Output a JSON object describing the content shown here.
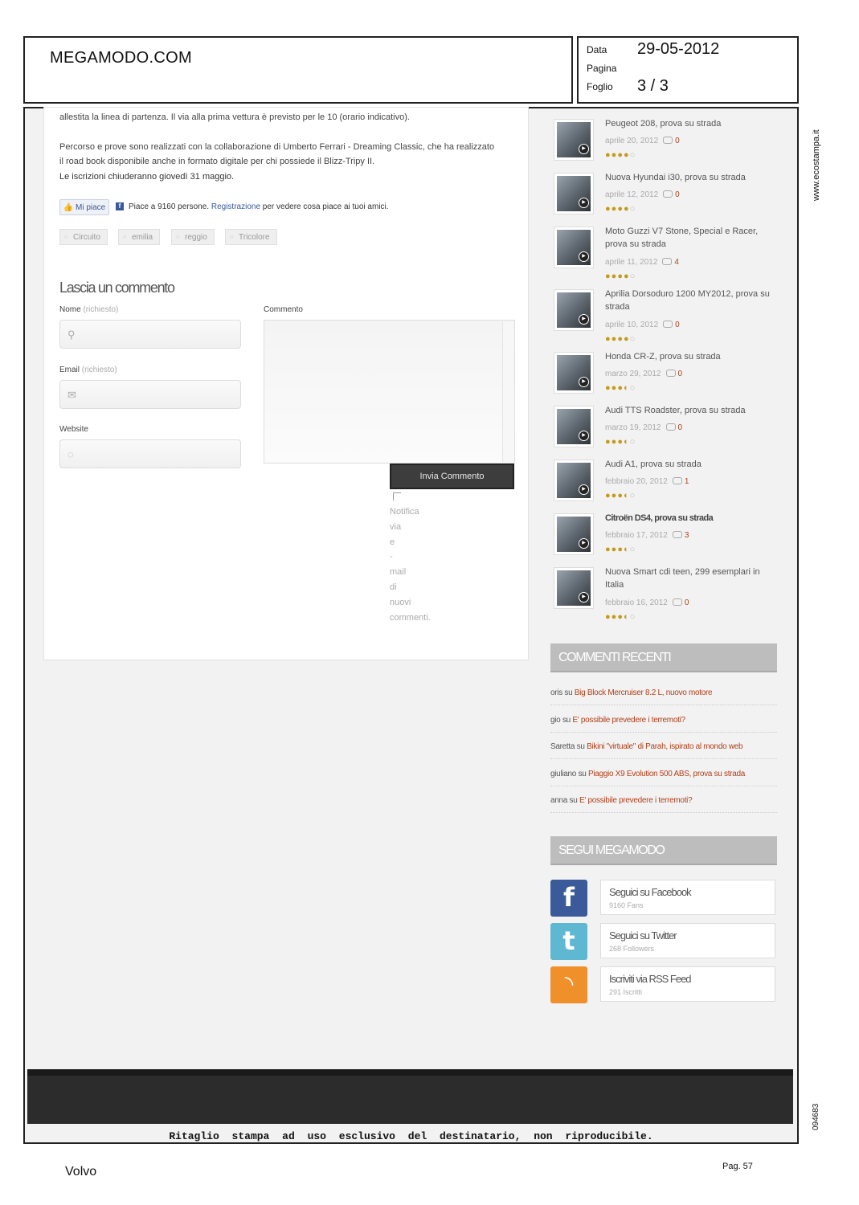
{
  "header": {
    "site": "MEGAMODO.COM",
    "data_label": "Data",
    "data_value": "29-05-2012",
    "pagina_label": "Pagina",
    "foglio_label": "Foglio",
    "foglio_value": "3 / 3"
  },
  "side_url": "www.ecostampa.it",
  "side_code": "094683",
  "article": {
    "line0": "allestita la linea di partenza. Il via alla prima vettura è previsto per le 10 (orario indicativo).",
    "line1": "Percorso e prove sono realizzati con la collaborazione di Umberto Ferrari -  Dreaming Classic, che ha realizzato",
    "line2": "il road book disponibile anche in formato digitale per chi possiede il Blizz-Tripy II.",
    "line3": "Le iscrizioni chiuderanno giovedì 31 maggio.",
    "like_button": "Mi piace",
    "like_text_pre": "Piace a 9160 persone.",
    "like_link": "Registrazione",
    "like_text_post": "per vedere cosa piace ai tuoi amici.",
    "tags": [
      "Circuito",
      "emilia",
      "reggio",
      "Tricolore"
    ]
  },
  "comment_form": {
    "title": "Lascia un commento",
    "name_label": "Nome",
    "email_label": "Email",
    "required": "(richiesto)",
    "website_label": "Website",
    "comment_label": "Commento",
    "submit": "Invia Commento",
    "notify_words": [
      "Notifica",
      "via",
      "e",
      "-",
      "mail",
      "di",
      "nuovi",
      "commenti."
    ]
  },
  "posts": [
    {
      "title": "Peugeot 208, prova su strada",
      "date": "aprile 20, 2012",
      "comments": "0",
      "rating": 4
    },
    {
      "title": "Nuova Hyundai i30, prova su strada",
      "date": "aprile 12, 2012",
      "comments": "0",
      "rating": 4
    },
    {
      "title": "Moto Guzzi V7 Stone, Special e Racer, prova su strada",
      "date": "aprile 11, 2012",
      "comments": "4",
      "rating": 4
    },
    {
      "title": "Aprilia Dorsoduro 1200 MY2012, prova su strada",
      "date": "aprile 10, 2012",
      "comments": "0",
      "rating": 4
    },
    {
      "title": "Honda CR-Z, prova su strada",
      "date": "marzo 29, 2012",
      "comments": "0",
      "rating": 3.5
    },
    {
      "title": "Audi TTS Roadster, prova su strada",
      "date": "marzo 19, 2012",
      "comments": "0",
      "rating": 3.5
    },
    {
      "title": "Audi A1, prova su strada",
      "date": "febbraio 20, 2012",
      "comments": "1",
      "rating": 3.5
    },
    {
      "title": "Citroën DS4, prova su strada",
      "date": "febbraio 17, 2012",
      "comments": "3",
      "rating": 3.5
    },
    {
      "title": "Nuova Smart cdi teen, 299 esemplari in Italia",
      "date": "febbraio 16, 2012",
      "comments": "0",
      "rating": 3.5
    }
  ],
  "recent_comments": {
    "title": "COMMENTI RECENTI",
    "items": [
      {
        "author": "oris",
        "on": "su",
        "post": "Big Block Mercruiser 8.2 L, nuovo motore"
      },
      {
        "author": "gio",
        "on": "su",
        "post": "E' possibile prevedere i terremoti?"
      },
      {
        "author": "Saretta",
        "on": "su",
        "post": "Bikini \"virtuale\" di Parah, ispirato al mondo web"
      },
      {
        "author": "giuliano",
        "on": "su",
        "post": "Piaggio X9 Evolution 500 ABS, prova su strada"
      },
      {
        "author": "anna",
        "on": "su",
        "post": "E' possibile prevedere i terremoti?"
      }
    ]
  },
  "follow": {
    "title": "SEGUI MEGAMODO",
    "items": [
      {
        "label": "Seguici su Facebook",
        "sub": "9160 Fans",
        "icon": "facebook-icon",
        "color": "#3b5a9a"
      },
      {
        "label": "Seguici su Twitter",
        "sub": "268 Followers",
        "icon": "twitter-icon",
        "color": "#5fb8d2"
      },
      {
        "label": "Iscriviti via RSS Feed",
        "sub": "291 Iscritti",
        "icon": "rss-icon",
        "color": "#f0902a"
      }
    ]
  },
  "disclaimer": "Ritaglio stampa ad uso esclusivo del destinatario, non riproducibile.",
  "client": "Volvo",
  "page_num": "Pag. 57"
}
